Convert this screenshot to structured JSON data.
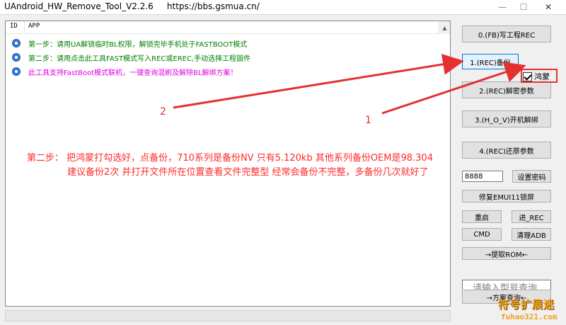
{
  "window": {
    "title": "UAndroid_HW_Remove_Tool_V2.2.6     https://bbs.gsmua.cn/",
    "minimize_glyph": "—",
    "maximize_glyph": "☐",
    "close_glyph": "✕"
  },
  "listview": {
    "columns": [
      "ID",
      "APP"
    ],
    "rows": [
      {
        "icon": "info-icon",
        "text": "第一步：请用UA解锁临时BL权限，解锁完毕手机处于FASTBOOT模式",
        "color": "#008000"
      },
      {
        "icon": "info-icon",
        "text": "第二步：请用点击此工具FAST模式写入REC或EREC,手动选择工程固件",
        "color": "#008000"
      },
      {
        "icon": "info-icon",
        "text": "此工具支持FastBoot模式联机，一键查询混刷及解除BL解绑方案！",
        "color": "#e000e0"
      }
    ]
  },
  "annotations": {
    "line1": "第二步：   把鸿蒙打勾选好，点备份，710系列是备份NV 只有5.120kb  其他系列备份OEM是98.304",
    "line2": "建议备份2次  并打开文件所在位置查看文件完整型  经常会备份不完整，多备份几次就好了",
    "marker_1": "1",
    "marker_2": "2",
    "color": "#ff2a2a"
  },
  "buttons": {
    "write_rec": "0.(FB)写工程REC",
    "backup": "1.(REC)备份",
    "decrypt": "2.(REC)解密参数",
    "unbind": "3.(H_O_V)开机解绑",
    "restore": "4.(REC)还原参数",
    "set_password": "设置密码",
    "fix_emui": "修复EMUI11锁屏",
    "reboot": "重启",
    "enter_rec": "进_REC",
    "cmd": "CMD",
    "clear_adb": "清理ADB",
    "extract_rom": "→提取ROM←",
    "solution_query": "→方案查询←"
  },
  "harmony_checkbox": {
    "label": "鸿蒙",
    "checked": true
  },
  "password_field": {
    "value": "8888"
  },
  "model_search": {
    "placeholder": "请输入型号查询"
  },
  "watermark": {
    "title": "符号扩展迷",
    "url": "fuhao321.com"
  }
}
